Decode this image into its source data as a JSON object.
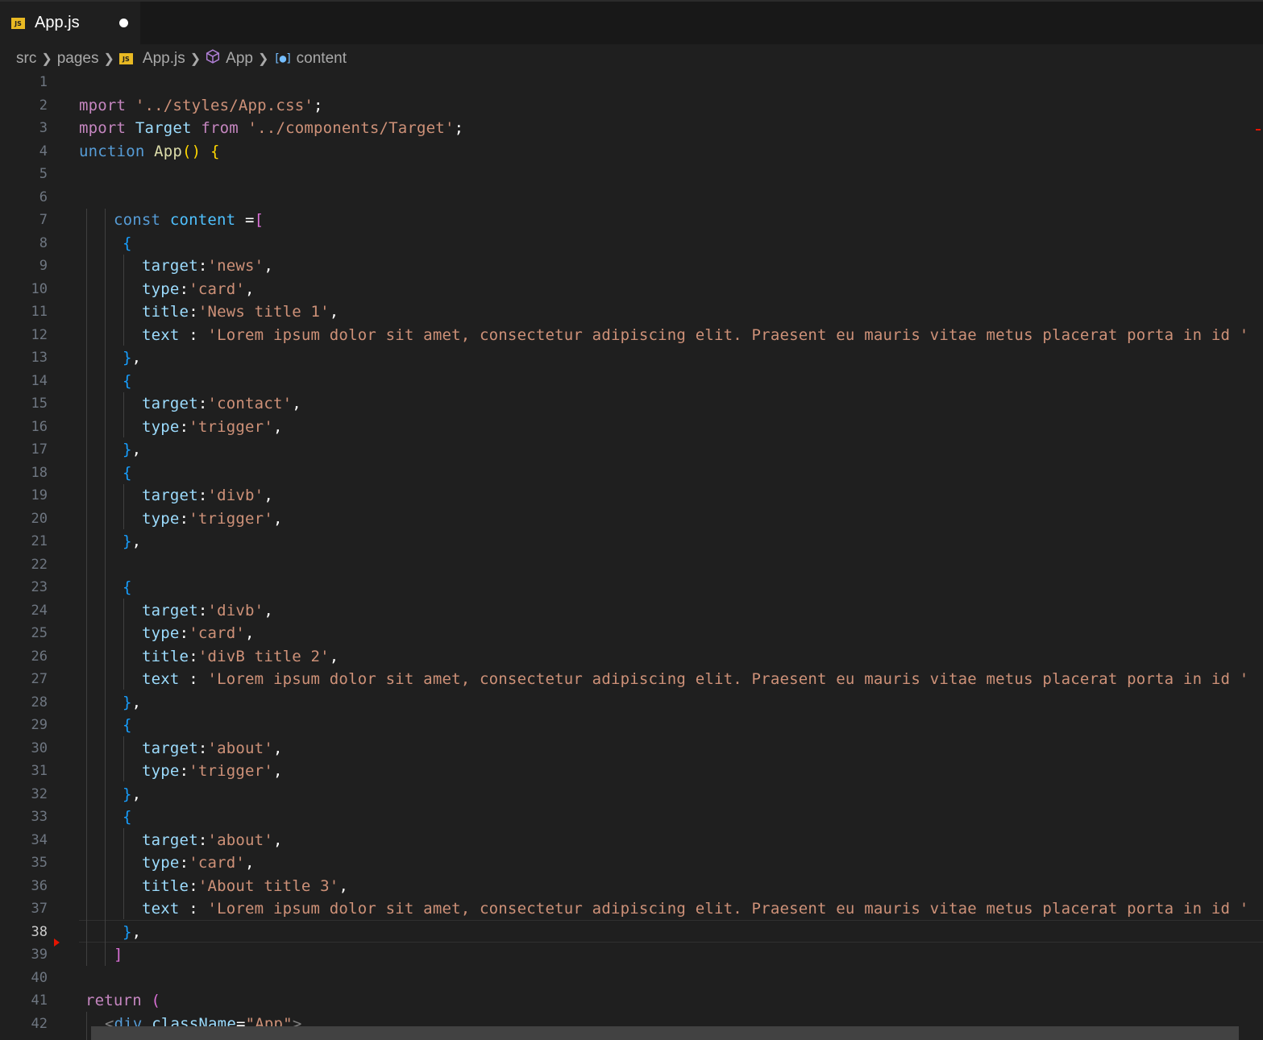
{
  "tab": {
    "label": "App.js",
    "icon": "js-file-icon",
    "dirty": true
  },
  "breadcrumb": {
    "items": [
      "src",
      "pages",
      "App.js",
      "App",
      "content"
    ]
  },
  "editor": {
    "active_line": 38,
    "lines": [
      {
        "n": "1",
        "t": []
      },
      {
        "n": "2",
        "t": [
          [
            "kw",
            "mport "
          ],
          [
            "st",
            "'../styles/App.css'"
          ],
          [
            "pr",
            ";"
          ]
        ]
      },
      {
        "n": "3",
        "t": [
          [
            "kw",
            "mport "
          ],
          [
            "lb",
            "Target "
          ],
          [
            "kw",
            "from "
          ],
          [
            "st",
            "'../components/Target'"
          ],
          [
            "pr",
            ";"
          ]
        ]
      },
      {
        "n": "4",
        "t": [
          [
            "bl",
            "unction "
          ],
          [
            "fn",
            "App"
          ],
          [
            "y",
            "() {"
          ]
        ]
      },
      {
        "n": "5",
        "t": []
      },
      {
        "n": "6",
        "t": []
      },
      {
        "n": "7",
        "t": [
          [
            "bl",
            "const "
          ],
          [
            "cb",
            "content "
          ],
          [
            "pr",
            "="
          ],
          [
            "pk",
            "["
          ]
        ]
      },
      {
        "n": "8",
        "t": [
          [
            "br",
            "{"
          ]
        ]
      },
      {
        "n": "9",
        "t": [
          [
            "lb",
            "target"
          ],
          [
            "pr",
            ":"
          ],
          [
            "st",
            "'news'"
          ],
          [
            "pr",
            ","
          ]
        ]
      },
      {
        "n": "10",
        "t": [
          [
            "lb",
            "type"
          ],
          [
            "pr",
            ":"
          ],
          [
            "st",
            "'card'"
          ],
          [
            "pr",
            ","
          ]
        ]
      },
      {
        "n": "11",
        "t": [
          [
            "lb",
            "title"
          ],
          [
            "pr",
            ":"
          ],
          [
            "st",
            "'News title 1'"
          ],
          [
            "pr",
            ","
          ]
        ]
      },
      {
        "n": "12",
        "t": [
          [
            "lb",
            "text "
          ],
          [
            "pr",
            ": "
          ],
          [
            "st",
            "'Lorem ipsum dolor sit amet, consectetur adipiscing elit. Praesent eu mauris vitae metus placerat porta in id '"
          ]
        ]
      },
      {
        "n": "13",
        "t": [
          [
            "br",
            "}"
          ],
          [
            "pr",
            ","
          ]
        ]
      },
      {
        "n": "14",
        "t": [
          [
            "br",
            "{"
          ]
        ]
      },
      {
        "n": "15",
        "t": [
          [
            "lb",
            "target"
          ],
          [
            "pr",
            ":"
          ],
          [
            "st",
            "'contact'"
          ],
          [
            "pr",
            ","
          ]
        ]
      },
      {
        "n": "16",
        "t": [
          [
            "lb",
            "type"
          ],
          [
            "pr",
            ":"
          ],
          [
            "st",
            "'trigger'"
          ],
          [
            "pr",
            ","
          ]
        ]
      },
      {
        "n": "17",
        "t": [
          [
            "br",
            "}"
          ],
          [
            "pr",
            ","
          ]
        ]
      },
      {
        "n": "18",
        "t": [
          [
            "br",
            "{"
          ]
        ]
      },
      {
        "n": "19",
        "t": [
          [
            "lb",
            "target"
          ],
          [
            "pr",
            ":"
          ],
          [
            "st",
            "'divb'"
          ],
          [
            "pr",
            ","
          ]
        ]
      },
      {
        "n": "20",
        "t": [
          [
            "lb",
            "type"
          ],
          [
            "pr",
            ":"
          ],
          [
            "st",
            "'trigger'"
          ],
          [
            "pr",
            ","
          ]
        ]
      },
      {
        "n": "21",
        "t": [
          [
            "br",
            "}"
          ],
          [
            "pr",
            ","
          ]
        ]
      },
      {
        "n": "22",
        "t": []
      },
      {
        "n": "23",
        "t": [
          [
            "br",
            "{"
          ]
        ]
      },
      {
        "n": "24",
        "t": [
          [
            "lb",
            "target"
          ],
          [
            "pr",
            ":"
          ],
          [
            "st",
            "'divb'"
          ],
          [
            "pr",
            ","
          ]
        ]
      },
      {
        "n": "25",
        "t": [
          [
            "lb",
            "type"
          ],
          [
            "pr",
            ":"
          ],
          [
            "st",
            "'card'"
          ],
          [
            "pr",
            ","
          ]
        ]
      },
      {
        "n": "26",
        "t": [
          [
            "lb",
            "title"
          ],
          [
            "pr",
            ":"
          ],
          [
            "st",
            "'divB title 2'"
          ],
          [
            "pr",
            ","
          ]
        ]
      },
      {
        "n": "27",
        "t": [
          [
            "lb",
            "text "
          ],
          [
            "pr",
            ": "
          ],
          [
            "st",
            "'Lorem ipsum dolor sit amet, consectetur adipiscing elit. Praesent eu mauris vitae metus placerat porta in id '"
          ]
        ]
      },
      {
        "n": "28",
        "t": [
          [
            "br",
            "}"
          ],
          [
            "pr",
            ","
          ]
        ]
      },
      {
        "n": "29",
        "t": [
          [
            "br",
            "{"
          ]
        ]
      },
      {
        "n": "30",
        "t": [
          [
            "lb",
            "target"
          ],
          [
            "pr",
            ":"
          ],
          [
            "st",
            "'about'"
          ],
          [
            "pr",
            ","
          ]
        ]
      },
      {
        "n": "31",
        "t": [
          [
            "lb",
            "type"
          ],
          [
            "pr",
            ":"
          ],
          [
            "st",
            "'trigger'"
          ],
          [
            "pr",
            ","
          ]
        ]
      },
      {
        "n": "32",
        "t": [
          [
            "br",
            "}"
          ],
          [
            "pr",
            ","
          ]
        ]
      },
      {
        "n": "33",
        "t": [
          [
            "br",
            "{"
          ]
        ]
      },
      {
        "n": "34",
        "t": [
          [
            "lb",
            "target"
          ],
          [
            "pr",
            ":"
          ],
          [
            "st",
            "'about'"
          ],
          [
            "pr",
            ","
          ]
        ]
      },
      {
        "n": "35",
        "t": [
          [
            "lb",
            "type"
          ],
          [
            "pr",
            ":"
          ],
          [
            "st",
            "'card'"
          ],
          [
            "pr",
            ","
          ]
        ]
      },
      {
        "n": "36",
        "t": [
          [
            "lb",
            "title"
          ],
          [
            "pr",
            ":"
          ],
          [
            "st",
            "'About title 3'"
          ],
          [
            "pr",
            ","
          ]
        ]
      },
      {
        "n": "37",
        "t": [
          [
            "lb",
            "text "
          ],
          [
            "pr",
            ": "
          ],
          [
            "st",
            "'Lorem ipsum dolor sit amet, consectetur adipiscing elit. Praesent eu mauris vitae metus placerat porta in id '"
          ]
        ]
      },
      {
        "n": "38",
        "t": [
          [
            "br",
            "}"
          ],
          [
            "pr",
            ","
          ]
        ]
      },
      {
        "n": "39",
        "t": [
          [
            "pk",
            "]"
          ]
        ]
      },
      {
        "n": "40",
        "t": []
      },
      {
        "n": "41",
        "t": [
          [
            "kw",
            "return "
          ],
          [
            "pk",
            "("
          ]
        ]
      },
      {
        "n": "42",
        "t": [
          [
            "tg",
            "<"
          ],
          [
            "tn",
            "div "
          ],
          [
            "at",
            "className"
          ],
          [
            "pr",
            "="
          ],
          [
            "st",
            "\"App\""
          ],
          [
            "tg",
            ">"
          ]
        ]
      }
    ]
  }
}
